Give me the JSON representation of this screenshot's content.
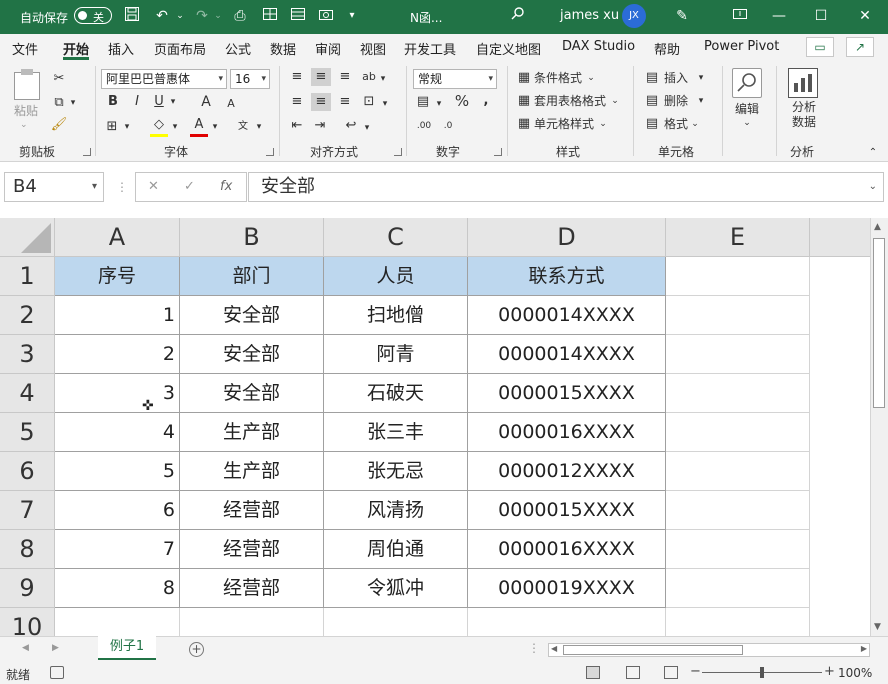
{
  "titlebar": {
    "autosave_label": "自动保存",
    "autosave_state": "关",
    "document_title": "N函...",
    "user_name": "james xu",
    "user_initials": "JX",
    "brand_color": "#217346"
  },
  "ribbon_tabs": [
    "文件",
    "开始",
    "插入",
    "页面布局",
    "公式",
    "数据",
    "审阅",
    "视图",
    "开发工具",
    "自定义地图",
    "DAX Studio",
    "帮助",
    "Power Pivot"
  ],
  "ribbon": {
    "clipboard": {
      "paste": "粘贴",
      "label": "剪贴板"
    },
    "font": {
      "name": "阿里巴巴普惠体",
      "size": "16",
      "bold": "B",
      "italic": "I",
      "underline": "U",
      "grow": "A",
      "shrink": "A",
      "label": "字体"
    },
    "alignment": {
      "label": "对齐方式"
    },
    "number": {
      "format": "常规",
      "label": "数字"
    },
    "styles": {
      "conditional": "条件格式",
      "table": "套用表格格式",
      "cell": "单元格样式",
      "label": "样式"
    },
    "cells": {
      "insert": "插入",
      "delete": "删除",
      "format": "格式",
      "label": "单元格"
    },
    "editing": {
      "label": "编辑"
    },
    "analysis": {
      "button": "分析数据",
      "label": "分析"
    }
  },
  "formula_bar": {
    "name_box": "B4",
    "fx": "fx",
    "value": "安全部"
  },
  "grid": {
    "columns": [
      "A",
      "B",
      "C",
      "D",
      "E"
    ],
    "rows": [
      "1",
      "2",
      "3",
      "4",
      "5",
      "6",
      "7",
      "8",
      "9",
      "10"
    ],
    "header_fill": "#bdd7ee",
    "headers": [
      "序号",
      "部门",
      "人员",
      "联系方式"
    ],
    "data": [
      [
        "1",
        "安全部",
        "扫地僧",
        "0000014XXXX"
      ],
      [
        "2",
        "安全部",
        "阿青",
        "0000014XXXX"
      ],
      [
        "3",
        "安全部",
        "石破天",
        "0000015XXXX"
      ],
      [
        "4",
        "生产部",
        "张三丰",
        "0000016XXXX"
      ],
      [
        "5",
        "生产部",
        "张无忌",
        "0000012XXXX"
      ],
      [
        "6",
        "经营部",
        "风清扬",
        "0000015XXXX"
      ],
      [
        "7",
        "经营部",
        "周伯通",
        "0000016XXXX"
      ],
      [
        "8",
        "经营部",
        "令狐冲",
        "0000019XXXX"
      ]
    ]
  },
  "sheets": [
    "例子1"
  ],
  "status": {
    "mode": "就绪",
    "zoom": "100%"
  }
}
